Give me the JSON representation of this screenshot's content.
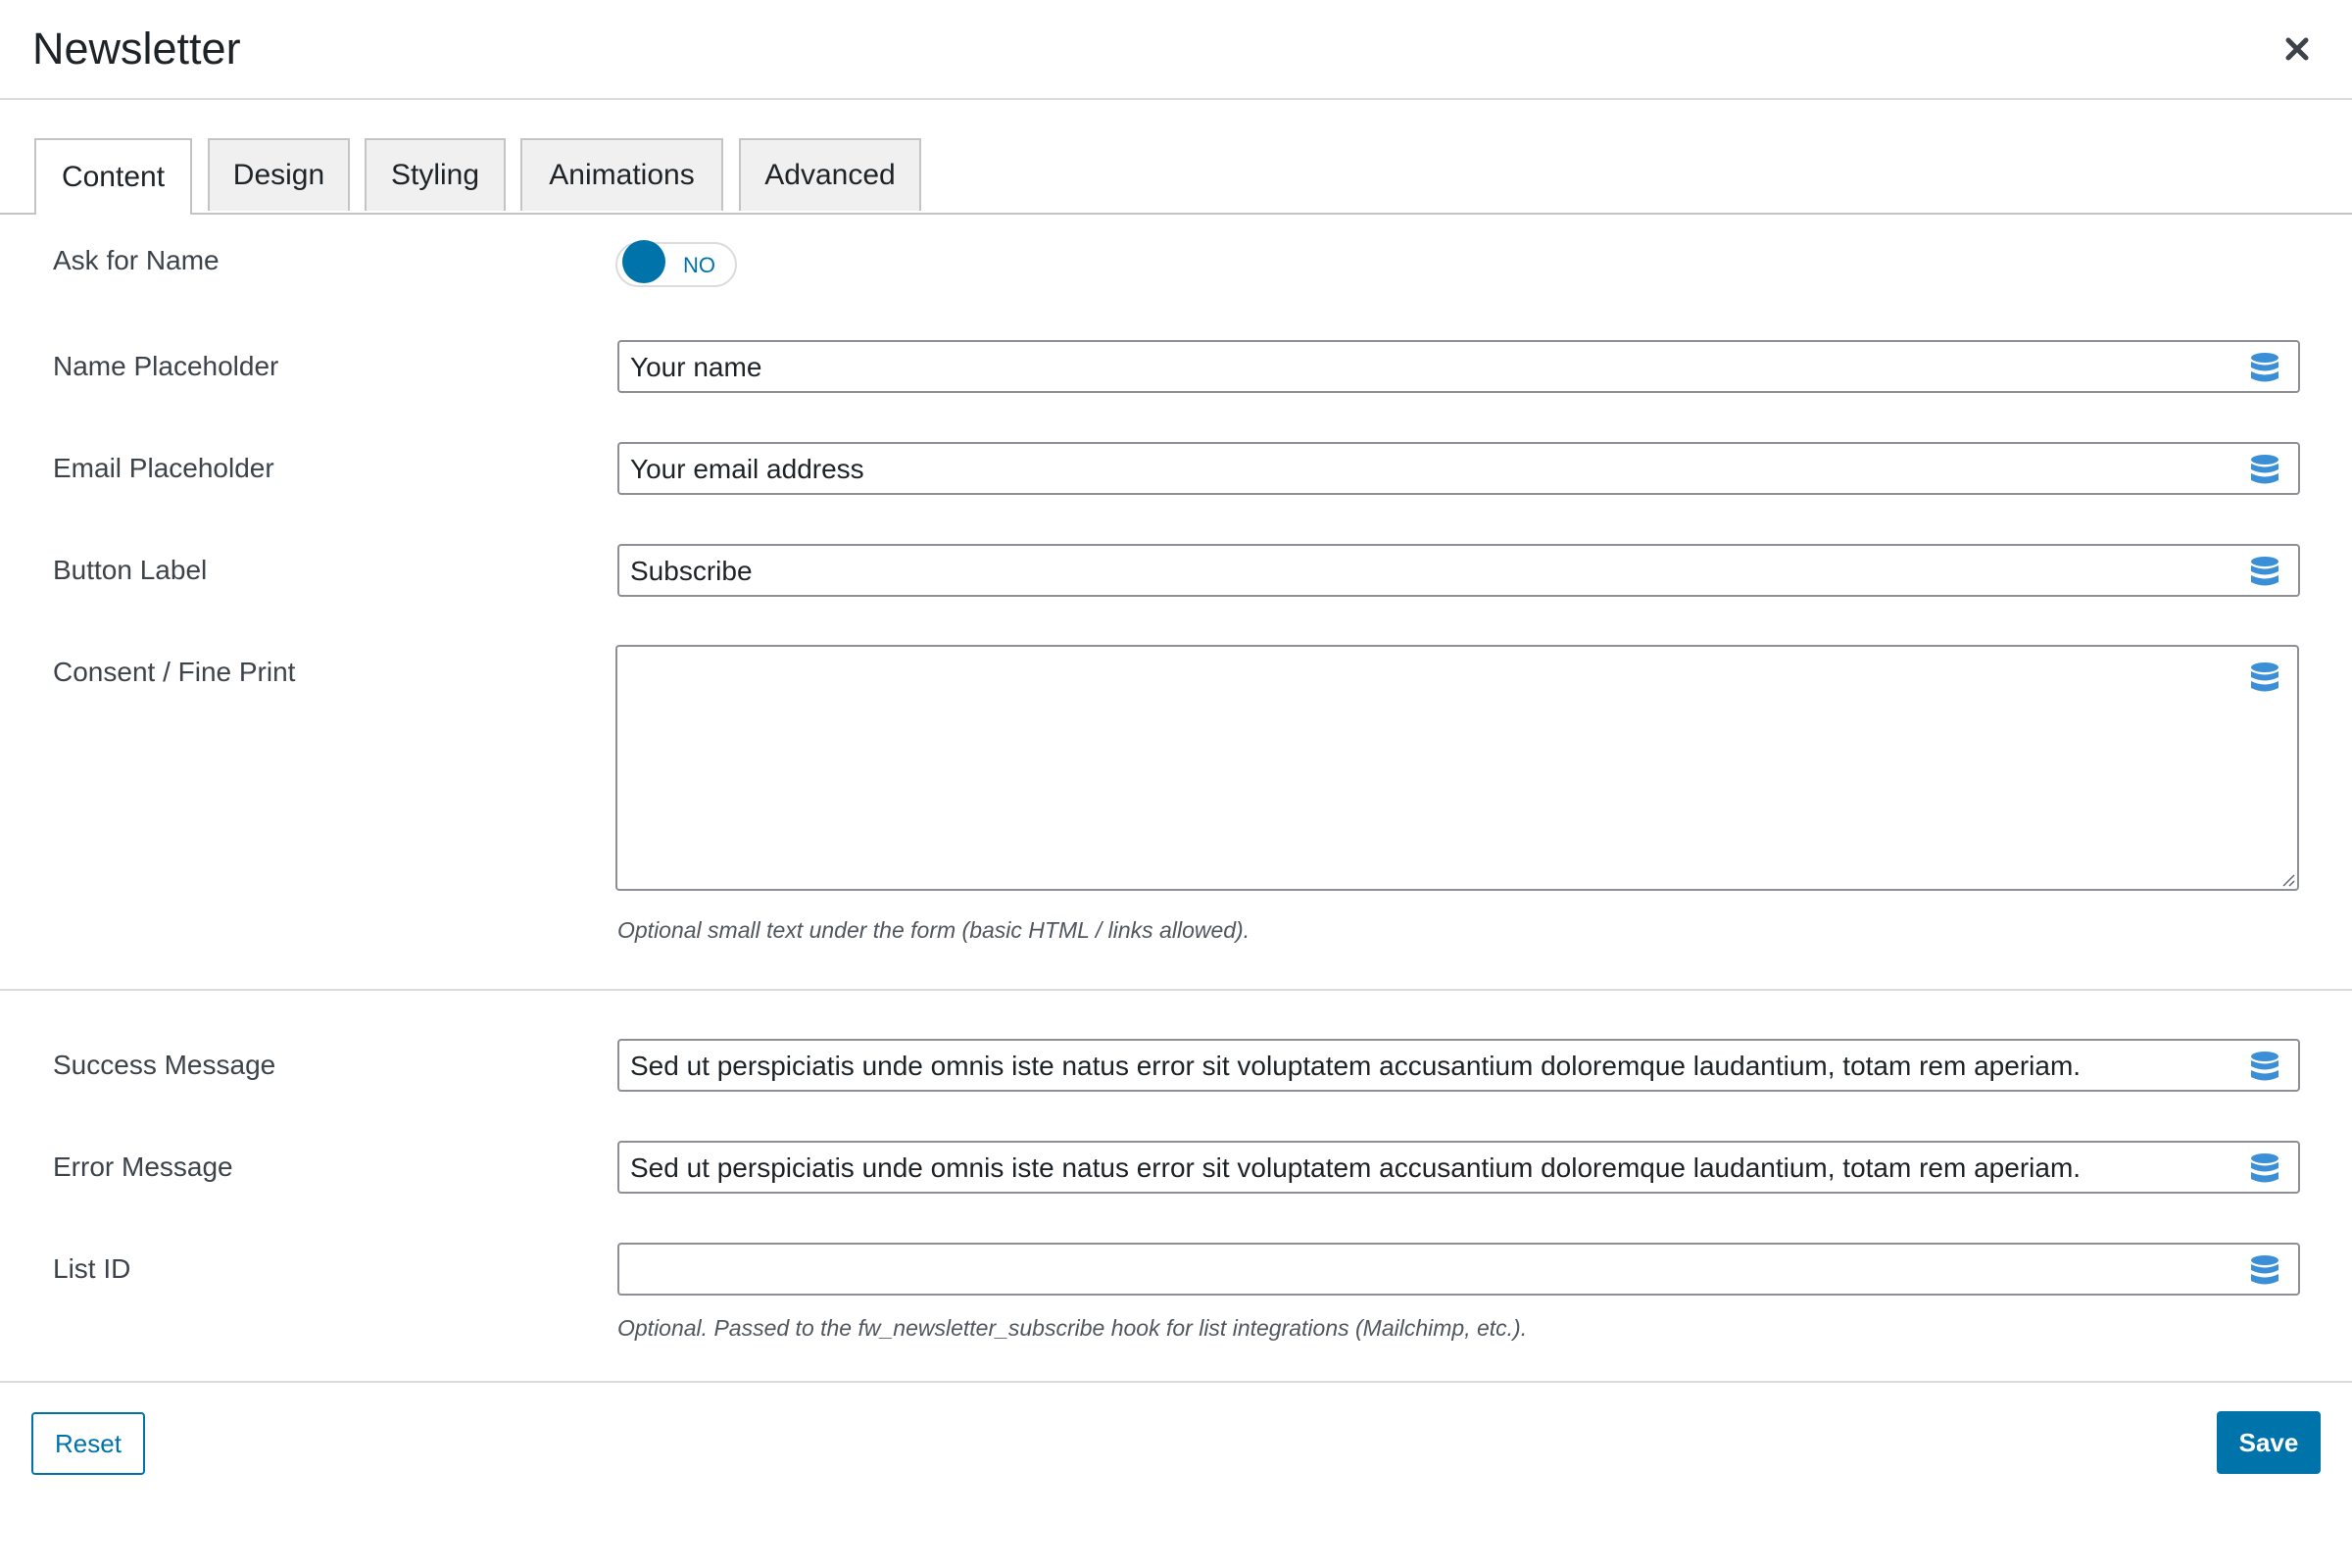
{
  "modal": {
    "title": "Newsletter",
    "close_icon": "close-icon"
  },
  "tabs": [
    {
      "label": "Content",
      "active": true
    },
    {
      "label": "Design",
      "active": false
    },
    {
      "label": "Styling",
      "active": false
    },
    {
      "label": "Animations",
      "active": false
    },
    {
      "label": "Advanced",
      "active": false
    }
  ],
  "fields": {
    "ask_name": {
      "label": "Ask for Name",
      "state": "NO"
    },
    "name_placeholder": {
      "label": "Name Placeholder",
      "value": "Your name"
    },
    "email_placeholder": {
      "label": "Email Placeholder",
      "value": "Your email address"
    },
    "button_label": {
      "label": "Button Label",
      "value": "Subscribe"
    },
    "consent": {
      "label": "Consent / Fine Print",
      "value": "",
      "help": "Optional small text under the form (basic HTML / links allowed)."
    },
    "success_message": {
      "label": "Success Message",
      "value": "Sed ut perspiciatis unde omnis iste natus error sit voluptatem accusantium doloremque laudantium, totam rem aperiam."
    },
    "error_message": {
      "label": "Error Message",
      "value": "Sed ut perspiciatis unde omnis iste natus error sit voluptatem accusantium doloremque laudantium, totam rem aperiam."
    },
    "list_id": {
      "label": "List ID",
      "value": "",
      "help": "Optional. Passed to the fw_newsletter_subscribe hook for list integrations (Mailchimp, etc.)."
    }
  },
  "footer": {
    "reset_label": "Reset",
    "save_label": "Save"
  },
  "colors": {
    "accent": "#0073aa",
    "db_icon": "#3a8fd6",
    "border": "#8c8f94"
  }
}
